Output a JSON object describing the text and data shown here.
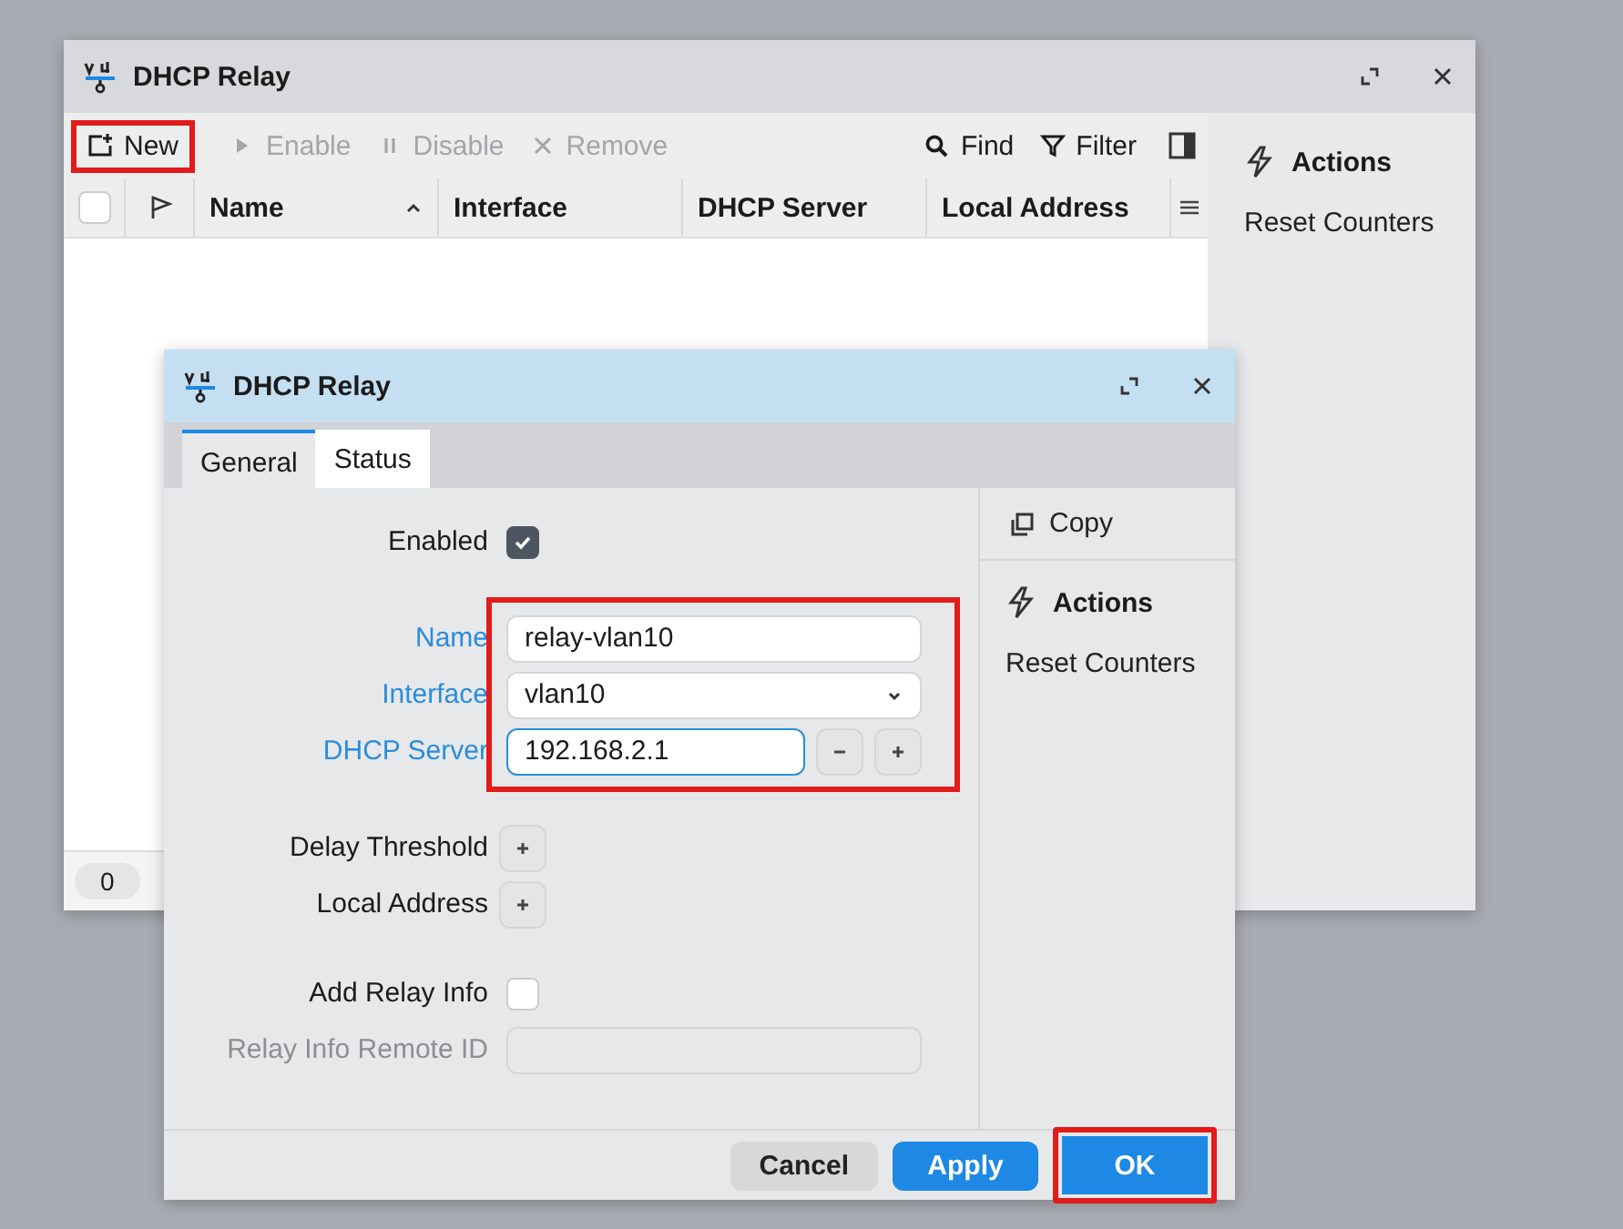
{
  "main_window": {
    "title": "DHCP Relay",
    "toolbar": [
      {
        "kind": "new",
        "label": "New",
        "disabled": false,
        "highlighted": true
      },
      {
        "kind": "enable",
        "label": "Enable",
        "disabled": true,
        "highlighted": false
      },
      {
        "kind": "disable",
        "label": "Disable",
        "disabled": true,
        "highlighted": false
      },
      {
        "kind": "remove",
        "label": "Remove",
        "disabled": true,
        "highlighted": false
      }
    ],
    "tools": [
      {
        "kind": "find",
        "label": "Find"
      },
      {
        "kind": "filter",
        "label": "Filter"
      }
    ],
    "all_checked": false,
    "columns": [
      {
        "label": "Name",
        "sorted": true
      },
      {
        "label": "Interface",
        "sorted": false
      },
      {
        "label": "DHCP Server",
        "sorted": false
      },
      {
        "label": "Local Address",
        "sorted": false
      }
    ],
    "row_count": "0",
    "side_panel": {
      "title": "Actions",
      "items": [
        "Reset Counters"
      ]
    }
  },
  "dialog": {
    "title": "DHCP Relay",
    "tabs": [
      {
        "label": "General",
        "selected": true
      },
      {
        "label": "Status",
        "selected": false
      }
    ],
    "sections": [
      {
        "highlighted": false,
        "rows": [
          {
            "kind": "checkbox",
            "label": "Enabled",
            "required": false,
            "checked": true
          }
        ]
      },
      {
        "highlighted": true,
        "rows": [
          {
            "kind": "text",
            "label": "Name",
            "required": true,
            "value": "relay-vlan10",
            "disabled": false
          },
          {
            "kind": "select",
            "label": "Interface",
            "required": true,
            "value": "vlan10"
          },
          {
            "kind": "multi",
            "label": "DHCP Server",
            "required": true,
            "value": "192.168.2.1",
            "focused": true
          }
        ]
      },
      {
        "highlighted": false,
        "rows": [
          {
            "kind": "add",
            "label": "Delay Threshold",
            "required": false
          },
          {
            "kind": "add",
            "label": "Local Address",
            "required": false
          }
        ]
      },
      {
        "highlighted": false,
        "rows": [
          {
            "kind": "checkbox",
            "label": "Add Relay Info",
            "required": false,
            "checked": false
          },
          {
            "kind": "text",
            "label": "Relay Info Remote ID",
            "required": false,
            "value": "",
            "disabled": true
          }
        ]
      }
    ],
    "side": {
      "copy": "Copy",
      "title": "Actions",
      "items": [
        "Reset Counters"
      ]
    },
    "buttons": [
      {
        "kind": "secondary",
        "label": "Cancel",
        "highlighted": false
      },
      {
        "kind": "primary",
        "label": "Apply",
        "highlighted": false
      },
      {
        "kind": "primary",
        "label": "OK",
        "highlighted": true
      }
    ]
  }
}
